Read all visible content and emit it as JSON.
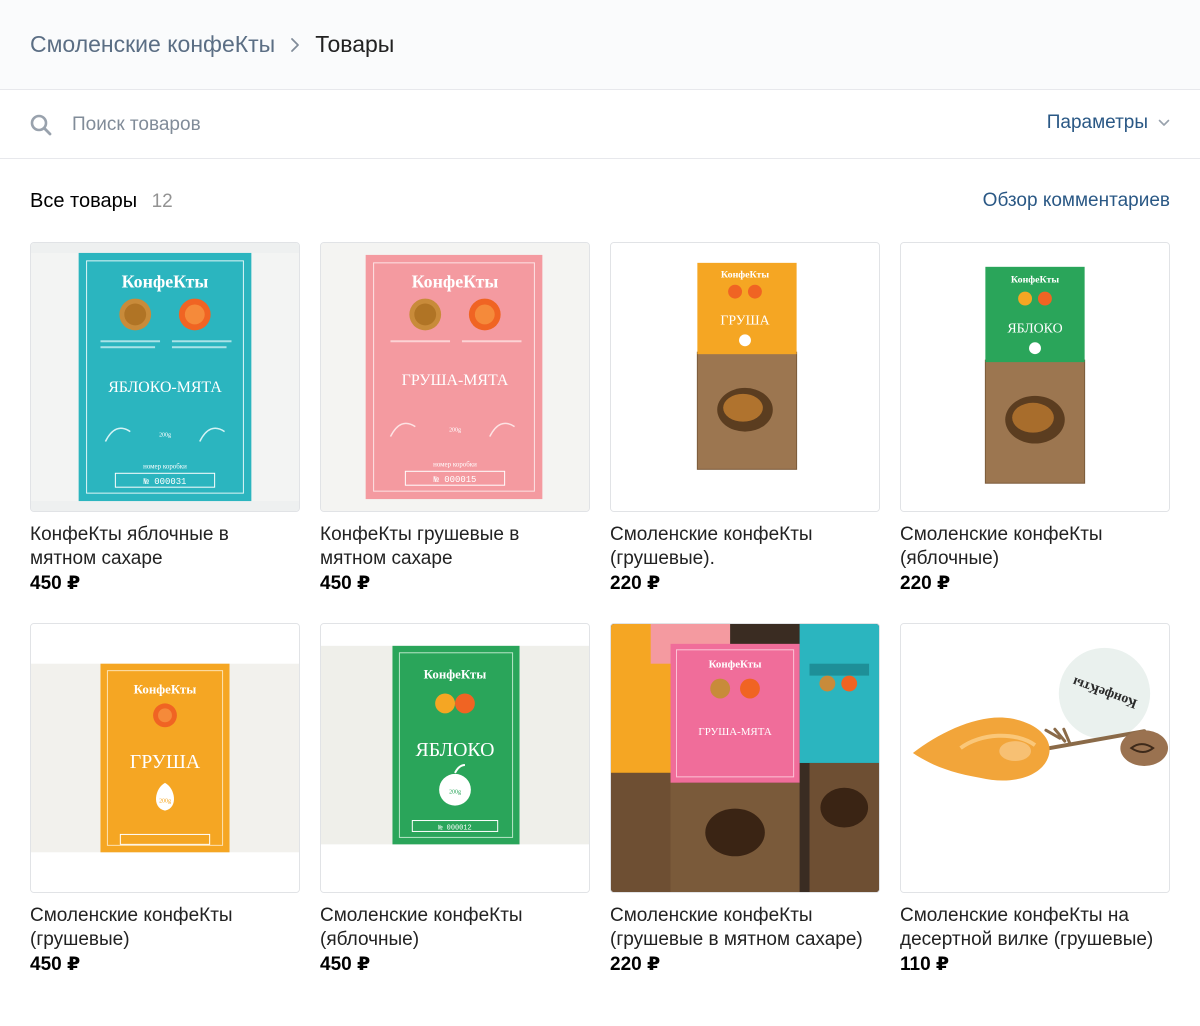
{
  "breadcrumb": {
    "root": "Смоленские конфеКты",
    "current": "Товары"
  },
  "search": {
    "placeholder": "Поиск товаров",
    "params_label": "Параметры"
  },
  "section": {
    "title": "Все товары",
    "count": "12",
    "reviews_link": "Обзор комментариев"
  },
  "colors": {
    "link": "#2a5885",
    "teal": "#2bb5bf",
    "pink": "#f49aa0",
    "orange": "#f5a623",
    "green": "#2aa55a",
    "kraft": "#8f6b48"
  },
  "products": [
    {
      "title": "КонфеКты яблочные в мятном сахаре",
      "price": "450 ₽",
      "image": "teal-box-apple-mint",
      "pack": {
        "brand": "КонфеКты",
        "flavor": "ЯБЛОКО-МЯТА",
        "number": "№ 000031",
        "box_label": "номер коробки",
        "weight": "200g"
      }
    },
    {
      "title": "КонфеКты грушевые в мятном сахаре",
      "price": "450 ₽",
      "image": "pink-box-pear-mint",
      "pack": {
        "brand": "КонфеКты",
        "flavor": "ГРУША-МЯТА",
        "number": "№ 000015",
        "box_label": "номер коробки",
        "weight": "200g"
      }
    },
    {
      "title": "Смоленские конфеКты (грушевые).",
      "price": "220 ₽",
      "image": "orange-kraft-bag-pear",
      "pack": {
        "brand": "КонфеКты",
        "flavor": "ГРУША"
      }
    },
    {
      "title": "Смоленские конфеКты (яблочные)",
      "price": "220 ₽",
      "image": "green-kraft-bag-apple",
      "pack": {
        "brand": "КонфеКты",
        "flavor": "ЯБЛОКО"
      }
    },
    {
      "title": "Смоленские конфеКты (грушевые)",
      "price": "450 ₽",
      "image": "orange-box-pear",
      "pack": {
        "brand": "КонфеКты",
        "flavor": "ГРУША",
        "weight": "200g"
      }
    },
    {
      "title": "Смоленские конфеКты (яблочные)",
      "price": "450 ₽",
      "image": "green-box-apple",
      "pack": {
        "brand": "КонфеКты",
        "flavor": "ЯБЛОКО",
        "weight": "200g",
        "number": "№ 000012"
      }
    },
    {
      "title": "Смоленские конфеКты (грушевые в мятном сахаре)",
      "price": "220 ₽",
      "image": "assorted-bags",
      "pack": {
        "brand": "КонфеКты",
        "flavor": "ГРУША-МЯТА"
      }
    },
    {
      "title": "Смоленские конфеКты на десертной вилке (грушевые)",
      "price": "110 ₽",
      "image": "candy-on-fork",
      "pack": {
        "brand": "КонфеКты"
      }
    }
  ]
}
